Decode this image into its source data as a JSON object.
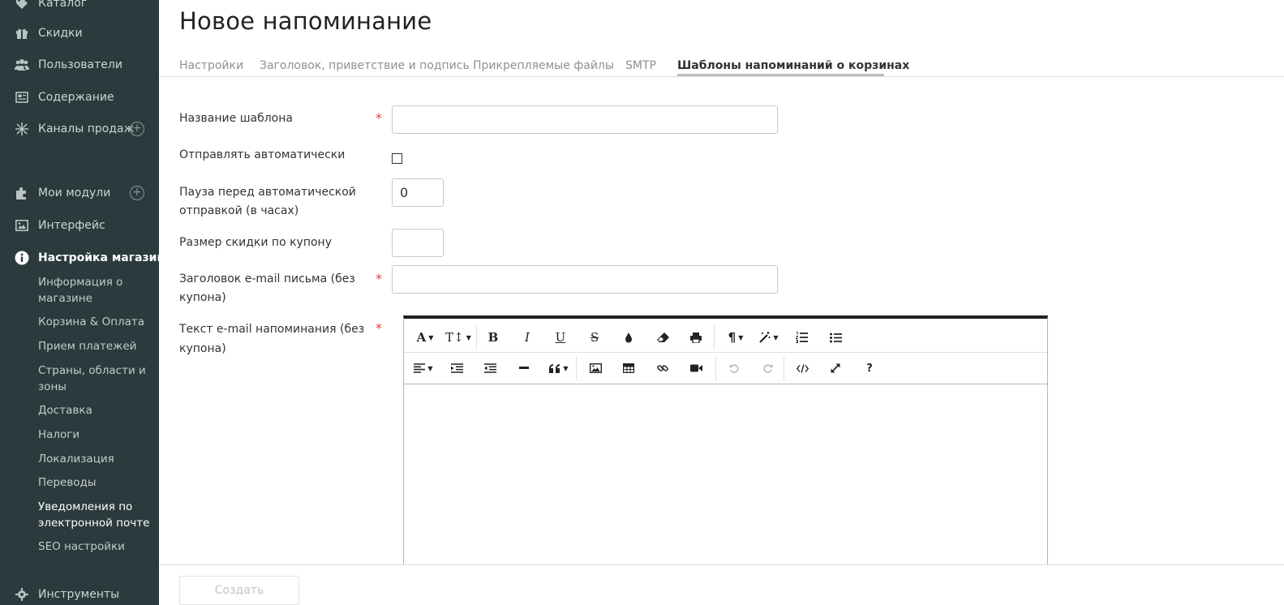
{
  "sidebar": {
    "items": [
      {
        "label": "Каталог",
        "icon": "tag-icon"
      },
      {
        "label": "Скидки",
        "icon": "gift-icon"
      },
      {
        "label": "Пользователи",
        "icon": "users-icon"
      },
      {
        "label": "Содержание",
        "icon": "newspaper-icon"
      },
      {
        "label": "Каналы продаж",
        "icon": "channels-icon"
      },
      {
        "label": "Мои модули",
        "icon": "puzzle-icon"
      },
      {
        "label": "Интерфейс",
        "icon": "image-icon"
      },
      {
        "label": "Настройка магазина",
        "icon": "info-icon"
      },
      {
        "label": "Инструменты",
        "icon": "gear-icon"
      }
    ],
    "sub_items": [
      "Информация о магазине",
      "Корзина & Оплата",
      "Прием платежей",
      "Страны, области и зоны",
      "Доставка",
      "Налоги",
      "Локализация",
      "Переводы",
      "Уведомления по электронной почте",
      "SEO настройки"
    ],
    "plus": "+"
  },
  "page": {
    "title": "Новое напоминание"
  },
  "tabs": [
    "Настройки",
    "Заголовок, приветствие и подпись",
    "Прикрепляемые файлы",
    "SMTP",
    "Шаблоны напоминаний о корзинах"
  ],
  "form": {
    "required_mark": "*",
    "template_name_label": "Название шаблона",
    "template_name_value": "",
    "auto_send_label": "Отправлять автоматически",
    "auto_send_checked": false,
    "pause_label_1": "Пауза перед автоматической",
    "pause_label_2": "отправкой (в часах)",
    "pause_value": "0",
    "discount_label": "Размер скидки по купону",
    "discount_value": "",
    "subject_label_1": "Заголовок e-mail письма (без",
    "subject_label_2": "купона)",
    "subject_value": "",
    "body_label_1": "Текст e-mail напоминания (без",
    "body_label_2": "купона)"
  },
  "editor": {
    "font_glyph": "A",
    "size_glyph": "T↕",
    "bold_glyph": "B",
    "italic_glyph": "I",
    "underline_glyph": "U",
    "strike_glyph": "S",
    "help_glyph": "?"
  },
  "footer": {
    "create_label": "Создать"
  }
}
